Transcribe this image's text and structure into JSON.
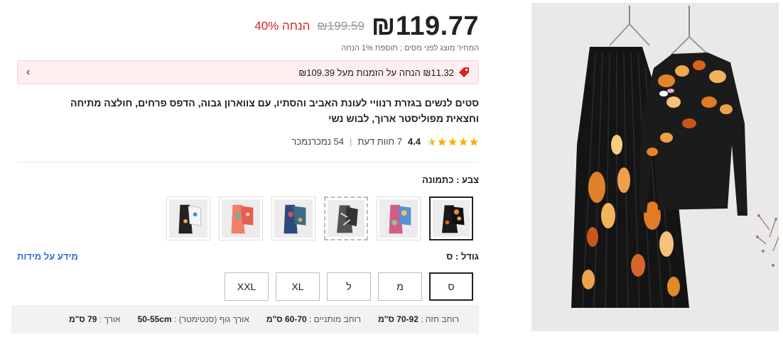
{
  "price": {
    "current": "₪119.77",
    "original": "₪199.59",
    "discount": "40% הנחה",
    "tax_note": "המחיר מוצג לפני מסים ; תוספת 1% הנחה"
  },
  "promo": {
    "text": "₪11.32 הנחה על הזמנות מעל ₪109.39",
    "icon": "tag-icon",
    "chevron": "‹"
  },
  "product": {
    "title": "סטים לנשים בגזרת רנוויי לעונת האביב והסתיו, עם צווארון גבוה, הדפס פרחים, חולצה מתיחה וחצאית מפוליסטר ארוך, לבוש נשי"
  },
  "rating": {
    "value": "4.4",
    "stars": 4.5,
    "reviews": "7 חוות דעת",
    "sold": "54 נמכרנמכר",
    "separator": "|"
  },
  "color": {
    "label": "צבע : כתמונה",
    "swatches": [
      "black-floral",
      "multicolor-print",
      "abstract-grey",
      "blue-teal-print",
      "coral-print",
      "white-black-print"
    ],
    "selected_index": 0
  },
  "size": {
    "label": "גודל : ס",
    "guide_link": "מידע על מידות",
    "options": [
      "ס",
      "מ",
      "ל",
      "XL",
      "XXL"
    ],
    "selected_index": 0
  },
  "measurements": {
    "chest": {
      "label": "רוחב חזה :",
      "value": "70-92 ס\"מ"
    },
    "hips": {
      "label": "רוחב מותניים :",
      "value": "60-70 ס\"מ"
    },
    "body": {
      "label": "אורך גוף (סנטימטר) :",
      "value": "50-55cm"
    },
    "length": {
      "label": "אורך :",
      "value": "79 ס\"מ"
    }
  },
  "colors": {
    "accent_red": "#d8232a",
    "promo_bg": "#fdeef0",
    "star": "#f5b301",
    "link_blue": "#2a6fd6"
  }
}
